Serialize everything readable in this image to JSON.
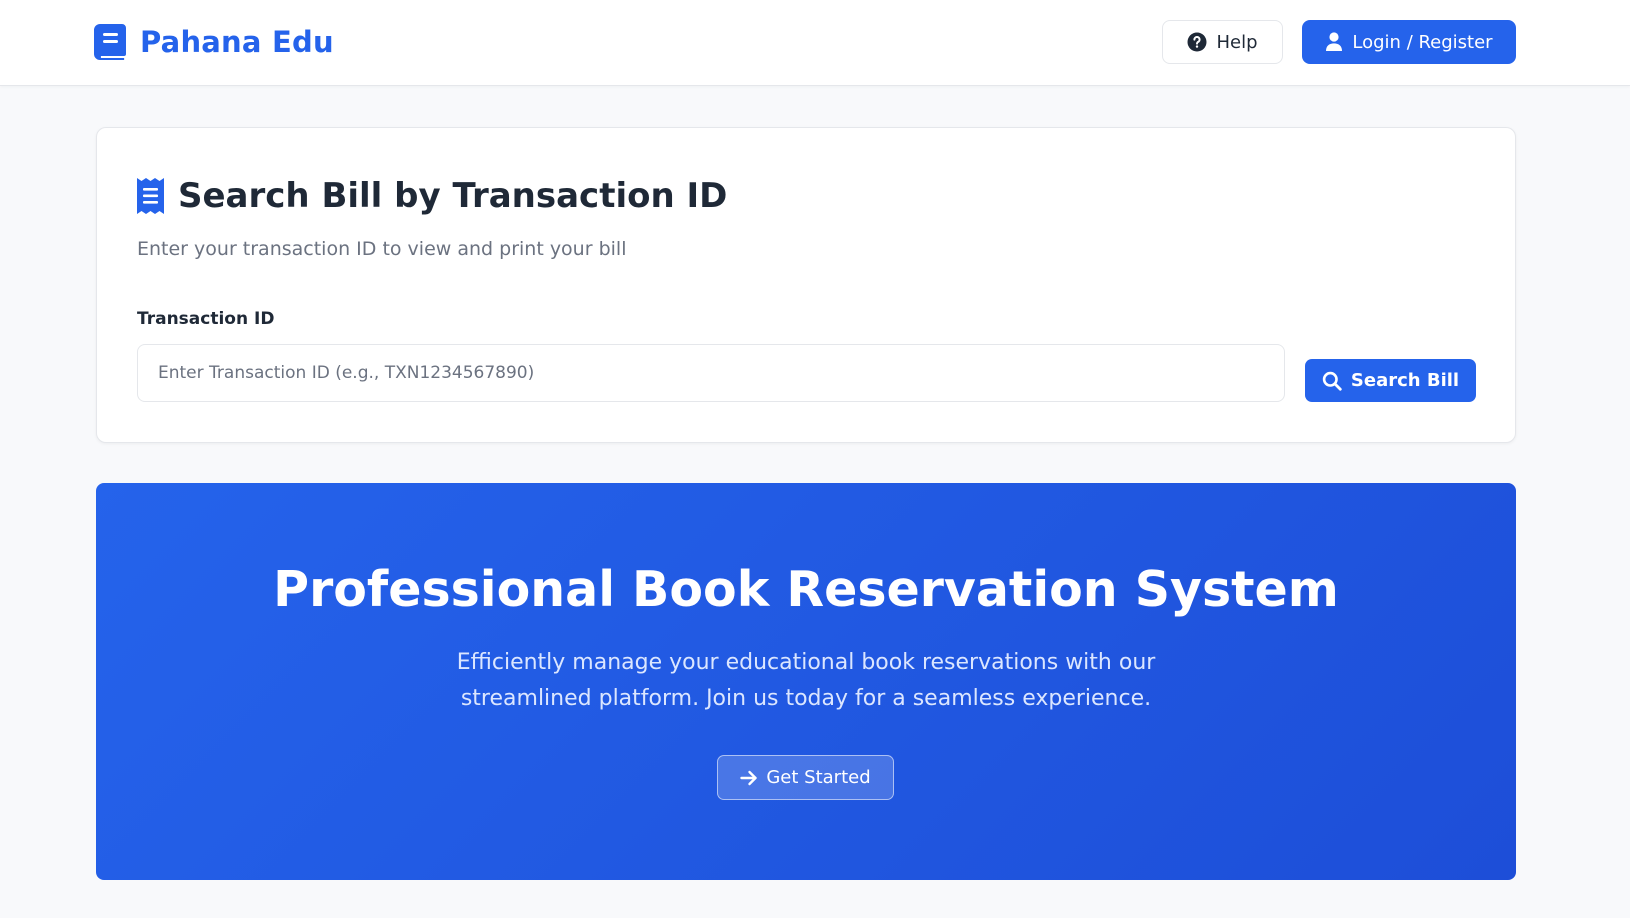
{
  "header": {
    "brand_name": "Pahana Edu",
    "brand_icon": "book-icon",
    "help_label": "Help",
    "help_icon": "question-circle-icon",
    "login_label": "Login / Register",
    "login_icon": "user-icon"
  },
  "search_card": {
    "title": "Search Bill by Transaction ID",
    "title_icon": "receipt-icon",
    "subtitle": "Enter your transaction ID to view and print your bill",
    "field_label": "Transaction ID",
    "input_value": "",
    "input_placeholder": "Enter Transaction ID (e.g., TXN1234567890)",
    "button_label": "Search Bill",
    "button_icon": "search-icon"
  },
  "hero": {
    "title": "Professional Book Reservation System",
    "description": "Efficiently manage your educational book reservations with our streamlined platform. Join us today for a seamless experience.",
    "cta_label": "Get Started",
    "cta_icon": "arrow-right-icon"
  },
  "colors": {
    "primary": "#2563eb",
    "primary_dark": "#1d4ed8",
    "text": "#1f2937",
    "muted": "#6b7280",
    "background": "#f8f9fb"
  }
}
